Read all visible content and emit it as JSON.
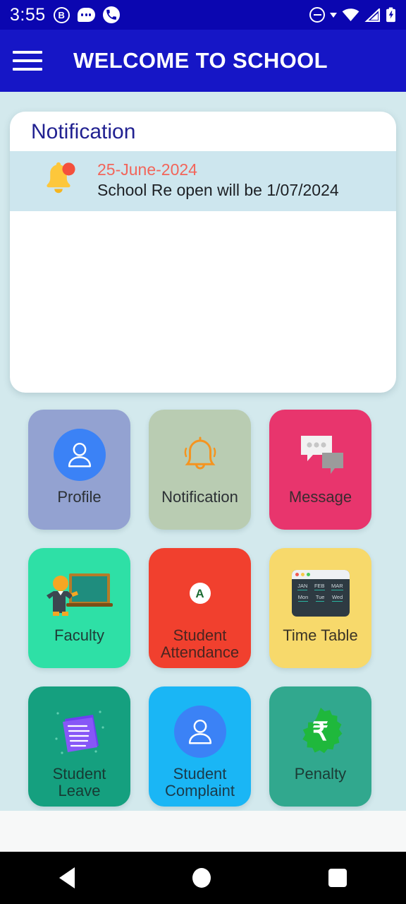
{
  "status_bar": {
    "time": "3:55",
    "left_icons": [
      "badge-b-icon",
      "chat-bubble-icon",
      "phone-call-icon"
    ],
    "right_icons": [
      "do-not-disturb-icon",
      "caret-down-icon",
      "wifi-icon",
      "cellular-signal-icon",
      "battery-charging-icon"
    ],
    "background": "#0b06b0"
  },
  "app_bar": {
    "menu_icon": "hamburger-menu-icon",
    "title": "WELCOME TO SCHOOL",
    "background": "#1616c6",
    "text_color": "#ffffff"
  },
  "notification_card": {
    "heading": "Notification",
    "heading_color": "#212191",
    "items": [
      {
        "icon": "bell-with-badge-icon",
        "date": "25-June-2024",
        "date_color": "#f2655a",
        "message": "School Re open will be 1/07/2024",
        "row_background": "#cde6ee"
      }
    ]
  },
  "menu_grid": {
    "tiles": [
      {
        "label": "Profile",
        "icon": "user-avatar-icon",
        "background": "#93a2d1",
        "icon_color": "#3b82f6",
        "label_color": "#2b3034"
      },
      {
        "label": "Notification",
        "icon": "bell-outline-icon",
        "background": "#b9ccb2",
        "icon_color": "#f5941f",
        "label_color": "#2b3034"
      },
      {
        "label": "Message",
        "icon": "chat-bubbles-icon",
        "background": "#e8356d",
        "icon_color": "#ffffff",
        "label_color": "#3a2b30"
      },
      {
        "label": "Faculty",
        "icon": "teacher-blackboard-icon",
        "background": "#2ee0a6",
        "icon_color": "#2f7d72",
        "label_color": "#1f3b36"
      },
      {
        "label": "Student\nAttendance",
        "icon": "attendance-grade-a-icon",
        "background": "#f1402e",
        "icon_color": "#ffffff",
        "label_color": "#4a2520"
      },
      {
        "label": "Time Table",
        "icon": "calendar-window-icon",
        "background": "#f7d96b",
        "icon_color": "#2e3a42",
        "label_color": "#3b3426"
      },
      {
        "label": "Student\nLeave",
        "icon": "documents-stack-icon",
        "background": "#15a07f",
        "icon_color": "#7b4cf0",
        "label_color": "#173a33"
      },
      {
        "label": "Student\nComplaint",
        "icon": "user-avatar-icon",
        "background": "#1ab6f5",
        "icon_color": "#3b82f6",
        "label_color": "#1b3a4a"
      },
      {
        "label": "Penalty",
        "icon": "rupee-badge-icon",
        "background": "#31a88e",
        "icon_color": "#1fb83c",
        "label_color": "#1b3b35"
      }
    ]
  },
  "timetable_icon": {
    "months": [
      "JAN",
      "FEB",
      "MAR"
    ],
    "days": [
      "Mon",
      "Tue",
      "Wed"
    ],
    "dots": [
      "#f15b4f",
      "#f7c948",
      "#49c95c"
    ]
  },
  "attendance_icon": {
    "grade": "A"
  },
  "penalty_icon": {
    "currency_symbol": "₹"
  },
  "navigation_bar": {
    "buttons": [
      "back-button",
      "home-button",
      "recents-button"
    ],
    "background": "#000000"
  },
  "page_background": "#d3e9ed"
}
